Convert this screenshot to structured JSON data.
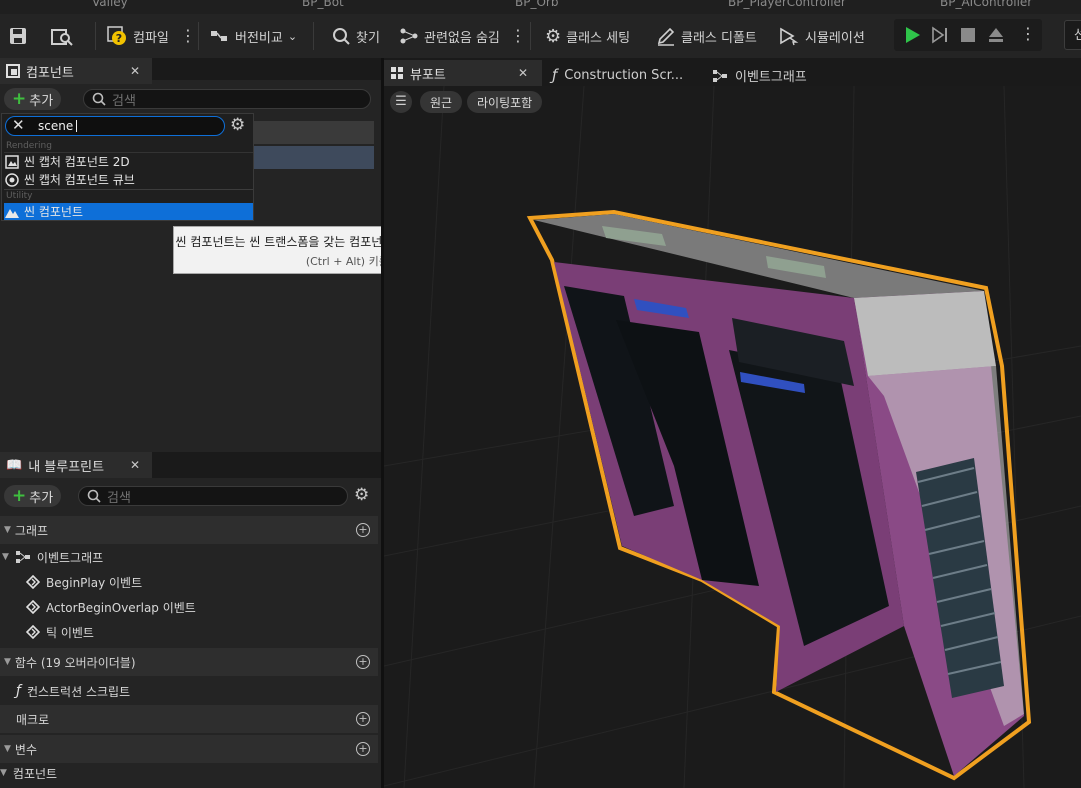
{
  "doc_tabs": [
    "Valley",
    "BP_Bot",
    "BP_Orb",
    "BP_PlayerController",
    "BP_AIController"
  ],
  "toolbar": {
    "compile": "컴파일",
    "diff": "버전비교",
    "find": "찾기",
    "hide_unrelated": "관련없음 숨김",
    "class_settings": "클래스 세팅",
    "class_defaults": "클래스 디폴트",
    "simulation": "시뮬레이션",
    "right_edge": "선"
  },
  "components_panel": {
    "title": "컴포넌트",
    "add_label": "추가",
    "search_placeholder": "검색"
  },
  "add_dropdown": {
    "search_value": "scene",
    "categories": [
      {
        "name": "Rendering",
        "items": [
          "씬 캡처 컴포넌트 2D",
          "씬 캡처 컴포넌트 큐브"
        ]
      },
      {
        "name": "Utility",
        "items": [
          "씬 컴포넌트"
        ]
      }
    ]
  },
  "tooltip": {
    "text": "씬 컴포넌트는 씬 트랜스폼을 갖는 컴포넌트로, 다른 씬 컴포넌트에 붙일 수 있습니다.",
    "hint": "(Ctrl + Alt) 키를 눌러 상세히 보기"
  },
  "my_blueprint": {
    "title": "내 블루프린트",
    "add_label": "추가",
    "search_placeholder": "검색",
    "sections": {
      "graphs": "그래프",
      "functions": "함수 (19 오버라이더블)",
      "macros": "매크로",
      "variables": "변수",
      "components": "컴포넌트"
    },
    "event_graph": "이벤트그래프",
    "events": [
      "BeginPlay 이벤트",
      "ActorBeginOverlap 이벤트",
      "틱 이벤트"
    ],
    "construction_script": "컨스트럭션 스크립트"
  },
  "viewport": {
    "tabs": [
      "뷰포트",
      "Construction Scr...",
      "이벤트그래프"
    ],
    "perspective": "원근",
    "lighting": "라이팅포함"
  },
  "colors": {
    "accent_select": "#0e6fd8",
    "play_green": "#2fc44a",
    "outline_orange": "#f0a020"
  }
}
